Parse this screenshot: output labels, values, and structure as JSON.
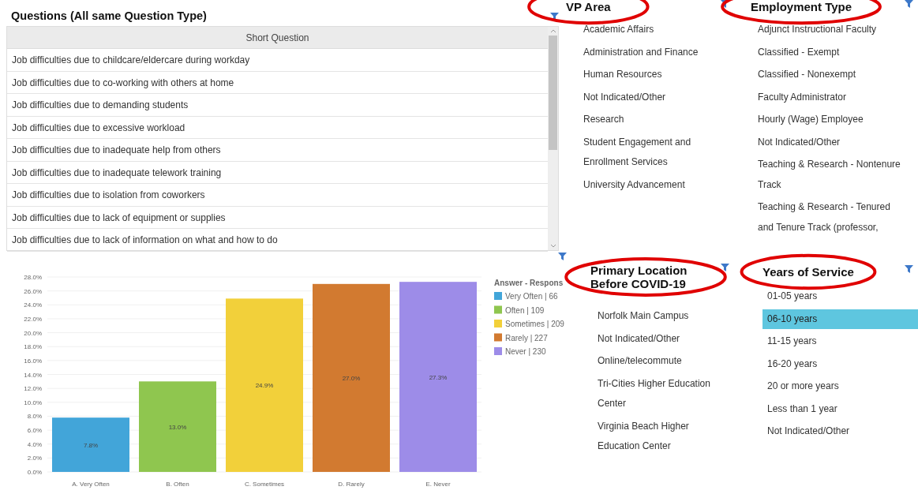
{
  "questions": {
    "title": "Questions (All same Question Type)",
    "column": "Short Question",
    "rows": [
      "Job difficulties due to childcare/eldercare during workday",
      "Job difficulties due to co-working with others at home",
      "Job difficulties due to demanding students",
      "Job difficulties due to excessive workload",
      "Job difficulties due to inadequate help from others",
      "Job difficulties due to inadequate telework training",
      "Job difficulties due to isolation from coworkers",
      "Job difficulties due to lack of equipment or supplies",
      "Job difficulties due to lack of information on what and how to do"
    ]
  },
  "chart": {
    "chart_data": {
      "type": "bar",
      "grid": true,
      "legend": {
        "title": "Answer - Respons"
      },
      "value_labels": [
        "7.8%",
        "13.0%",
        "24.9%",
        "27.0%",
        "27.3%"
      ],
      "categories": [
        "A. Very Often",
        "B. Often",
        "C. Sometimes",
        "D. Rarely",
        "E. Never"
      ],
      "series": [
        {
          "name": "Very Often | 66",
          "color": "#42a5d9",
          "values": [
            7.8,
            null,
            null,
            null,
            null
          ]
        },
        {
          "name": "Often | 109",
          "color": "#8fc64f",
          "values": [
            null,
            13.0,
            null,
            null,
            null
          ]
        },
        {
          "name": "Sometimes | 209",
          "color": "#f2d03a",
          "values": [
            null,
            null,
            24.9,
            null,
            null
          ]
        },
        {
          "name": "Rarely | 227",
          "color": "#d27a30",
          "values": [
            null,
            null,
            null,
            27.0,
            null
          ]
        },
        {
          "name": "Never | 230",
          "color": "#9d8ce8",
          "values": [
            null,
            null,
            null,
            null,
            27.3
          ]
        }
      ],
      "ylim": [
        0,
        28
      ],
      "yticks": [
        {
          "value": 0,
          "label": "0.0%"
        },
        {
          "value": 2,
          "label": "2.0%"
        },
        {
          "value": 4,
          "label": "4.0%"
        },
        {
          "value": 6,
          "label": "6.0%"
        },
        {
          "value": 8,
          "label": "8.0%"
        },
        {
          "value": 10,
          "label": "10.0%"
        },
        {
          "value": 12,
          "label": "12.0%"
        },
        {
          "value": 14,
          "label": "14.0%"
        },
        {
          "value": 16,
          "label": "16.0%"
        },
        {
          "value": 18,
          "label": "18.0%"
        },
        {
          "value": 20,
          "label": "20.0%"
        },
        {
          "value": 22,
          "label": "22.0%"
        },
        {
          "value": 24,
          "label": "24.0%"
        },
        {
          "value": 26,
          "label": "26.0%"
        },
        {
          "value": 28,
          "label": "28.0%"
        }
      ]
    }
  },
  "filters": [
    {
      "title": "VP Area",
      "circled": true,
      "items": [
        {
          "label": "Academic Affairs",
          "selected": false
        },
        {
          "label": "Administration and Finance",
          "selected": false
        },
        {
          "label": "Human Resources",
          "selected": false
        },
        {
          "label": "Not Indicated/Other",
          "selected": false
        },
        {
          "label": "Research",
          "selected": false
        },
        {
          "label": "Student Engagement and Enrollment Services",
          "selected": false
        },
        {
          "label": "University Advancement",
          "selected": false
        }
      ]
    },
    {
      "title": "Employment Type",
      "circled": true,
      "items": [
        {
          "label": "Adjunct Instructional Faculty",
          "selected": false
        },
        {
          "label": "Classified - Exempt",
          "selected": false
        },
        {
          "label": "Classified - Nonexempt",
          "selected": false
        },
        {
          "label": "Faculty Administrator",
          "selected": false
        },
        {
          "label": "Hourly (Wage) Employee",
          "selected": false
        },
        {
          "label": "Not Indicated/Other",
          "selected": false
        },
        {
          "label": "Teaching & Research - Nontenure Track",
          "selected": false
        },
        {
          "label": "Teaching & Research - Tenured and Tenure Track (professor,",
          "selected": false
        }
      ]
    },
    {
      "title": "Primary Location Before COVID-19",
      "circled": true,
      "items": [
        {
          "label": "Norfolk Main Campus",
          "selected": false
        },
        {
          "label": "Not Indicated/Other",
          "selected": false
        },
        {
          "label": "Online/telecommute",
          "selected": false
        },
        {
          "label": "Tri-Cities Higher Education Center",
          "selected": false
        },
        {
          "label": "Virginia Beach Higher Education Center",
          "selected": false
        }
      ]
    },
    {
      "title": "Years of Service",
      "circled": true,
      "items": [
        {
          "label": "01-05 years",
          "selected": false
        },
        {
          "label": "06-10 years",
          "selected": true
        },
        {
          "label": "11-15 years",
          "selected": false
        },
        {
          "label": "16-20 years",
          "selected": false
        },
        {
          "label": "20 or more years",
          "selected": false
        },
        {
          "label": "Less than 1 year",
          "selected": false
        },
        {
          "label": "Not Indicated/Other",
          "selected": false
        }
      ]
    }
  ]
}
